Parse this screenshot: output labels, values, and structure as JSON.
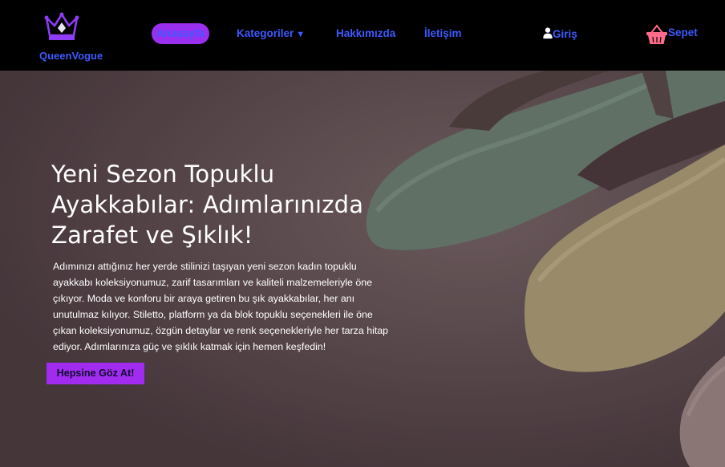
{
  "brand": {
    "name": "QueenVogue",
    "icon": "crown-icon"
  },
  "nav": {
    "home": "Anasayfa",
    "categories": "Kategoriler",
    "categories_caret": "▼",
    "about": "Hakkımızda",
    "contact": "İletişim",
    "login": "Giriş",
    "cart": "Sepet"
  },
  "hero": {
    "title": "Yeni Sezon Topuklu Ayakkabılar: Adımlarınızda Zarafet ve Şıklık!",
    "text": "Adımınızı attığınız her yerde stilinizi taşıyan yeni sezon kadın topuklu ayakkabı koleksiyonumuz, zarif tasarımları ve kaliteli malzemeleriyle öne çıkıyor. Moda ve konforu bir araya getiren bu şık ayakkabılar, her anı unutulmaz kılıyor. Stiletto, platform ya da blok topuklu seçenekleri ile öne çıkan koleksiyonumuz, özgün detaylar ve renk seçenekleriyle her tarza hitap ediyor. Adımlarınıza güç ve şıklık katmak için hemen keşfedin!",
    "button": "Hepsine Göz At!"
  },
  "colors": {
    "nav_link": "#3d5afe",
    "accent": "#9b2ff0",
    "cart_icon": "#ff6b8a",
    "header_bg": "#000000"
  }
}
